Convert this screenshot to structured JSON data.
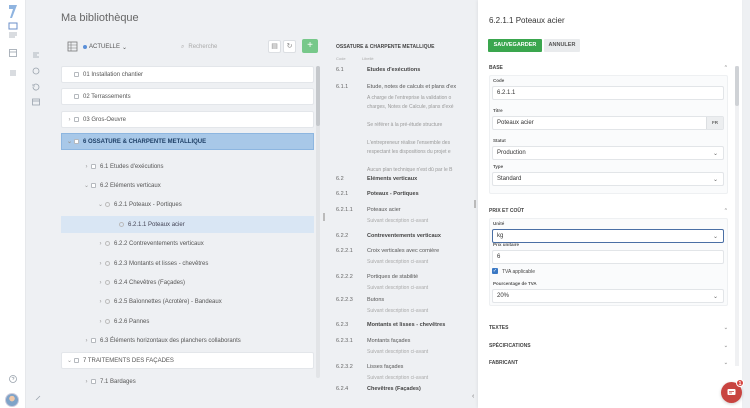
{
  "page_title": "Ma bibliothèque",
  "toolbar": {
    "filter_value": "ACTUELLE",
    "search_placeholder": "Recherche"
  },
  "tree": [
    {
      "label": "01  Installation chantier",
      "depth": 0,
      "style": "card",
      "chevron": ""
    },
    {
      "label": "02  Terrassements",
      "depth": 0,
      "style": "card",
      "chevron": ""
    },
    {
      "label": "03  Gros-Oeuvre",
      "depth": 0,
      "style": "card",
      "chevron": "›"
    },
    {
      "label": "6  OSSATURE & CHARPENTE METALLIQUE",
      "depth": 0,
      "style": "sel-major",
      "chevron": "⌄"
    },
    {
      "label": "6.1  Etudes d'exécutions",
      "depth": 1,
      "style": "",
      "chevron": "›"
    },
    {
      "label": "6.2  Eléments verticaux",
      "depth": 1,
      "style": "",
      "chevron": "⌄"
    },
    {
      "label": "6.2.1  Poteaux - Portiques",
      "depth": 2,
      "style": "",
      "chevron": "⌄"
    },
    {
      "label": "6.2.1.1  Poteaux acier",
      "depth": 3,
      "style": "sel-leaf",
      "chevron": ""
    },
    {
      "label": "6.2.2  Contreventements verticaux",
      "depth": 2,
      "style": "",
      "chevron": "›"
    },
    {
      "label": "6.2.3  Montants et lisses - chevêtres",
      "depth": 2,
      "style": "",
      "chevron": "›"
    },
    {
      "label": "6.2.4  Chevêtres (Façades)",
      "depth": 2,
      "style": "",
      "chevron": "›"
    },
    {
      "label": "6.2.5  Baïonnettes (Acrotère) - Bandeaux",
      "depth": 2,
      "style": "",
      "chevron": "›"
    },
    {
      "label": "6.2.6  Pannes",
      "depth": 2,
      "style": "",
      "chevron": "›"
    },
    {
      "label": "6.3  Éléments horizontaux des planchers collaborants",
      "depth": 1,
      "style": "",
      "chevron": "›"
    },
    {
      "label": "7  TRAITEMENTS DES FAÇADES",
      "depth": 0,
      "style": "card",
      "chevron": "⌄"
    },
    {
      "label": "7.1  Bardages",
      "depth": 1,
      "style": "",
      "chevron": "›"
    }
  ],
  "middle": {
    "header": "OSSATURE & CHARPENTE METALLIQUE",
    "col_code": "Code",
    "col_label": "Libellé",
    "rows": [
      {
        "code": "6.1",
        "label": "Etudes d'exécutions",
        "bold": true,
        "sub": ""
      },
      {
        "code": "6.1.1",
        "label": "Etude, notes de calculs et plans d'ex",
        "bold": false,
        "sub": ""
      },
      {
        "code": "6.2",
        "label": "Eléments verticaux",
        "bold": true,
        "sub": ""
      },
      {
        "code": "6.2.1",
        "label": "Poteaux - Portiques",
        "bold": true,
        "sub": ""
      },
      {
        "code": "6.2.1.1",
        "label": "Poteaux acier",
        "bold": false,
        "sub": "Suivant description ci-avant"
      },
      {
        "code": "6.2.2",
        "label": "Contreventements verticaux",
        "bold": true,
        "sub": ""
      },
      {
        "code": "6.2.2.1",
        "label": "Croix verticales avec cornière",
        "bold": false,
        "sub": "Suivant description ci-avant"
      },
      {
        "code": "6.2.2.2",
        "label": "Portiques de stabilité",
        "bold": false,
        "sub": "Suivant description ci-avant"
      },
      {
        "code": "6.2.2.3",
        "label": "Butons",
        "bold": false,
        "sub": "Suivant description ci-avant"
      },
      {
        "code": "6.2.3",
        "label": "Montants et lisses - chevêtres",
        "bold": true,
        "sub": ""
      },
      {
        "code": "6.2.3.1",
        "label": "Montants façades",
        "bold": false,
        "sub": "Suivant description ci-avant"
      },
      {
        "code": "6.2.3.2",
        "label": "Lisses façades",
        "bold": false,
        "sub": "Suivant description ci-avant"
      },
      {
        "code": "6.2.4",
        "label": "Chevêtres (Façades)",
        "bold": true,
        "sub": ""
      }
    ],
    "desc_lines": [
      "A charge de l'entreprise la validation o",
      "charges, Notes de Calcule, plans d'exé",
      "",
      "Se référer à la pré-étude structure",
      "",
      "L'entrepreneur réalise l'ensemble des",
      "respectant les dispositions du projet e",
      "",
      "Aucun plan technique n'est dû par le B"
    ]
  },
  "detail": {
    "title": "6.2.1.1 Poteaux acier",
    "save_label": "SAUVEGARDER",
    "cancel_label": "ANNULER",
    "section_base": "BASE",
    "code_label": "Code",
    "code_value": "6.2.1.1",
    "title_label": "Titre",
    "title_value": "Poteaux acier",
    "lang_badge": "FR",
    "status_label": "Statut",
    "status_value": "Production",
    "type_label": "Type",
    "type_value": "Standard",
    "section_price": "PRIX ET COÛT",
    "unit_label": "Unité",
    "unit_value": "kg",
    "unit_price_label": "Prix unitaire",
    "unit_price_value": "6",
    "vat_checked": true,
    "vat_label": "TVA applicable",
    "vat_pct_label": "Pourcentage de TVA",
    "vat_pct_value": "20%",
    "section_texts": "TEXTES",
    "section_specs": "SPÉCIFICATIONS",
    "section_maker": "FABRICANT"
  },
  "chat": {
    "badge": "1"
  },
  "colors": {
    "accent_green": "#3aa64e",
    "selection_blue": "#a8c8e8",
    "checkbox_blue": "#3a78c4",
    "chat_red": "#c84440"
  }
}
